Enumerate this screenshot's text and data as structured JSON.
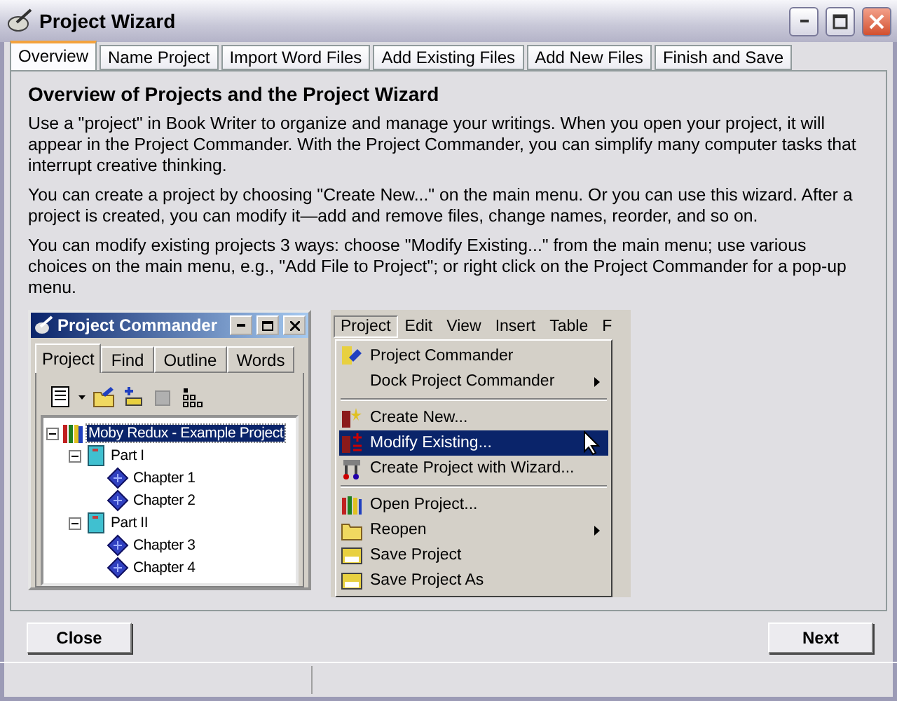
{
  "window": {
    "title": "Project Wizard"
  },
  "tabs": [
    {
      "label": "Overview",
      "selected": true
    },
    {
      "label": "Name Project",
      "selected": false
    },
    {
      "label": "Import Word Files",
      "selected": false
    },
    {
      "label": "Add Existing Files",
      "selected": false
    },
    {
      "label": "Add New Files",
      "selected": false
    },
    {
      "label": "Finish and Save",
      "selected": false
    }
  ],
  "heading": "Overview of Projects and the Project Wizard",
  "paragraphs": [
    "Use a \"project\" in Book Writer to organize and manage your writings.  When you open your project, it will appear in the Project Commander.  With the Project Commander, you can simplify many computer tasks that interrupt creative thinking.",
    "You can create a project by choosing \"Create New...\" on the main menu.  Or you can use this wizard.  After a project is created, you can modify it—add and remove files, change names, reorder, and so on.",
    "You can modify existing projects 3 ways:  choose \"Modify Existing...\" from the main menu; use various choices on the main menu, e.g., \"Add File to Project\"; or right click on the Project Commander for a pop-up menu."
  ],
  "commander": {
    "title": "Project Commander",
    "tabs": [
      {
        "label": "Project",
        "selected": true
      },
      {
        "label": "Find",
        "selected": false
      },
      {
        "label": "Outline",
        "selected": false
      },
      {
        "label": "Words",
        "selected": false
      }
    ],
    "tree": [
      {
        "label": "Moby Redux - Example Project",
        "kind": "project",
        "selected": true,
        "expanded": true,
        "children": [
          {
            "label": "Part I",
            "kind": "part",
            "selected": false,
            "expanded": true,
            "children": [
              {
                "label": "Chapter 1",
                "kind": "chapter",
                "selected": false
              },
              {
                "label": "Chapter 2",
                "kind": "chapter",
                "selected": false
              }
            ]
          },
          {
            "label": "Part II",
            "kind": "part",
            "selected": false,
            "expanded": true,
            "children": [
              {
                "label": "Chapter 3",
                "kind": "chapter",
                "selected": false
              },
              {
                "label": "Chapter 4",
                "kind": "chapter",
                "selected": false
              }
            ]
          }
        ]
      }
    ]
  },
  "menu": {
    "menubar": [
      {
        "label": "Project",
        "selected": true
      },
      {
        "label": "Edit",
        "selected": false
      },
      {
        "label": "View",
        "selected": false
      },
      {
        "label": "Insert",
        "selected": false
      },
      {
        "label": "Table",
        "selected": false
      },
      {
        "label": "F",
        "selected": false
      }
    ],
    "items": [
      {
        "kind": "item",
        "label": "Project Commander",
        "submenu": false,
        "selected": false
      },
      {
        "kind": "item",
        "label": "Dock Project Commander",
        "submenu": true,
        "selected": false
      },
      {
        "kind": "separator"
      },
      {
        "kind": "item",
        "label": "Create New...",
        "submenu": false,
        "selected": false
      },
      {
        "kind": "item",
        "label": "Modify Existing...",
        "submenu": false,
        "selected": true
      },
      {
        "kind": "item",
        "label": "Create Project with Wizard...",
        "submenu": false,
        "selected": false
      },
      {
        "kind": "separator"
      },
      {
        "kind": "item",
        "label": "Open Project...",
        "submenu": false,
        "selected": false
      },
      {
        "kind": "item",
        "label": "Reopen",
        "submenu": true,
        "selected": false
      },
      {
        "kind": "item",
        "label": "Save Project",
        "submenu": false,
        "selected": false
      },
      {
        "kind": "item",
        "label": "Save Project As",
        "submenu": false,
        "selected": false
      }
    ]
  },
  "buttons": [
    {
      "label": "Close"
    },
    {
      "label": "Next"
    }
  ]
}
